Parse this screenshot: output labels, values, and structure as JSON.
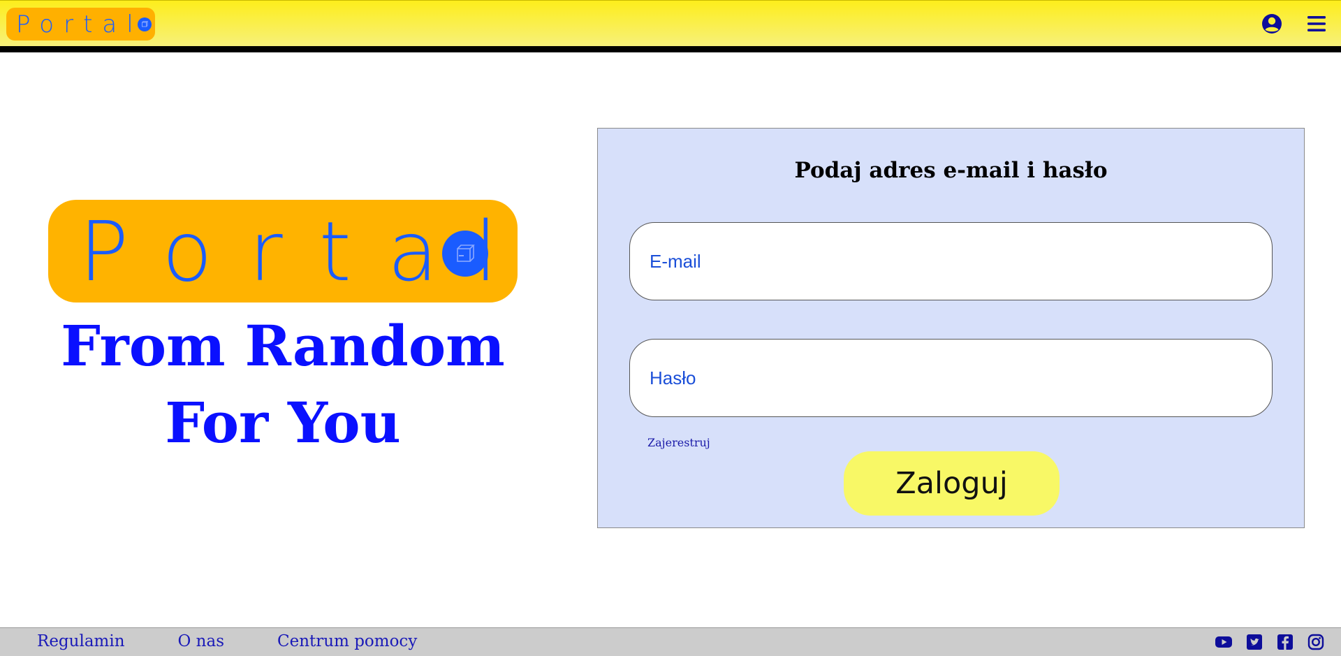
{
  "header": {
    "logo_text": "Portal",
    "icons": [
      "user-circle-icon",
      "hamburger-menu-icon"
    ]
  },
  "hero": {
    "logo_text": "Portal",
    "tagline_line1": "From Random",
    "tagline_line2": "For You"
  },
  "login": {
    "title": "Podaj adres e-mail i hasło",
    "email_placeholder": "E-mail",
    "password_placeholder": "Hasło",
    "register_label": "Zajerestruj",
    "submit_label": "Zaloguj"
  },
  "footer": {
    "links": [
      "Regulamin",
      "O nas",
      "Centrum pomocy"
    ],
    "social_icons": [
      "youtube-icon",
      "twitter-icon",
      "facebook-icon",
      "instagram-icon"
    ]
  },
  "colors": {
    "brand_blue": "#1a5cff",
    "logo_orange": "#ffb300",
    "header_yellow": "#fdee1c",
    "panel_bg": "#d7e0fa",
    "button_yellow": "#f8f866",
    "tagline_blue": "#0a10ff"
  }
}
